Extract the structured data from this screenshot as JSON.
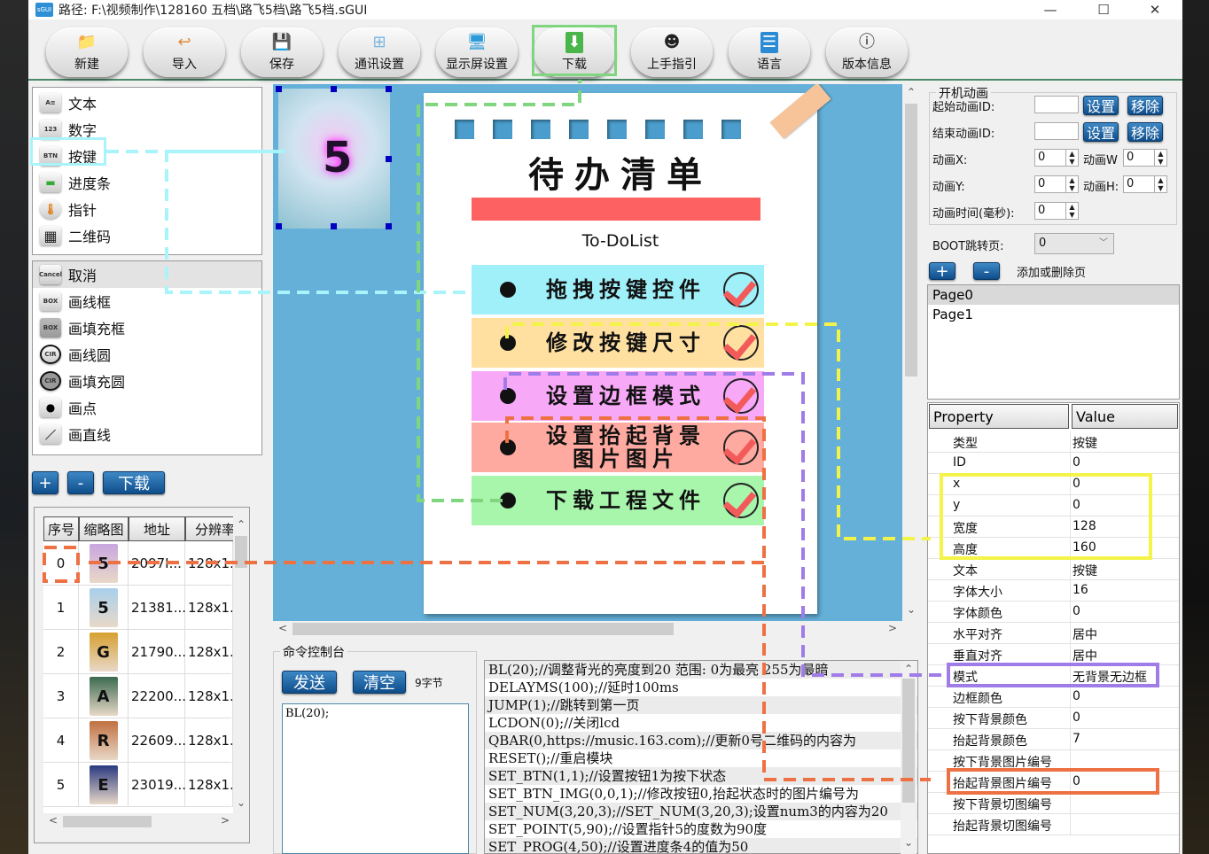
{
  "window": {
    "title": "路径: F:\\视频制作\\128160 五档\\路飞5档\\路飞5档.sGUI",
    "app_icon": "sGUI",
    "controls": {
      "minimize": "—",
      "maximize": "☐",
      "close": "✕"
    }
  },
  "toolbar": [
    {
      "label": "新建",
      "icon": "folder-icon",
      "glyph": "📁"
    },
    {
      "label": "导入",
      "icon": "import-icon",
      "glyph": "↩"
    },
    {
      "label": "保存",
      "icon": "save-icon",
      "glyph": "💾"
    },
    {
      "label": "通讯设置",
      "icon": "network-icon",
      "glyph": "⊞"
    },
    {
      "label": "显示屏设置",
      "icon": "monitor-icon",
      "glyph": "🖥"
    },
    {
      "label": "下载",
      "icon": "download-icon",
      "glyph": "⬇"
    },
    {
      "label": "上手指引",
      "icon": "support-icon",
      "glyph": "☻"
    },
    {
      "label": "语言",
      "icon": "list-icon",
      "glyph": "☰"
    },
    {
      "label": "版本信息",
      "icon": "info-icon",
      "glyph": "ⓘ"
    }
  ],
  "widgets": [
    {
      "label": "文本",
      "icon": "A≡"
    },
    {
      "label": "数字",
      "icon": "123"
    },
    {
      "label": "按键",
      "icon": "BTN"
    },
    {
      "label": "进度条",
      "icon": "▬"
    },
    {
      "label": "指针",
      "icon": "🌡"
    },
    {
      "label": "二维码",
      "icon": "▦"
    }
  ],
  "draw_tools": [
    {
      "label": "取消",
      "icon": "Cancel"
    },
    {
      "label": "画线框",
      "icon": "BOX"
    },
    {
      "label": "画填充框",
      "icon": "BOX"
    },
    {
      "label": "画线圆",
      "icon": "CIR"
    },
    {
      "label": "画填充圆",
      "icon": "CIR"
    },
    {
      "label": "画点",
      "icon": "●"
    },
    {
      "label": "画直线",
      "icon": "／"
    }
  ],
  "image_buttons": {
    "add": "+",
    "remove": "-",
    "download": "下载"
  },
  "image_table": {
    "headers": [
      "序号",
      "缩略图",
      "地址",
      "分辨率"
    ],
    "rows": [
      {
        "index": "0",
        "thumb_letter": "5",
        "address": "2097I...",
        "resolution": "128x1..."
      },
      {
        "index": "1",
        "thumb_letter": "5",
        "address": "21381...",
        "resolution": "128x1..."
      },
      {
        "index": "2",
        "thumb_letter": "G",
        "address": "21790...",
        "resolution": "128x1..."
      },
      {
        "index": "3",
        "thumb_letter": "A",
        "address": "22200...",
        "resolution": "128x1..."
      },
      {
        "index": "4",
        "thumb_letter": "R",
        "address": "22609...",
        "resolution": "128x1..."
      },
      {
        "index": "5",
        "thumb_letter": "E",
        "address": "23019...",
        "resolution": "128x1..."
      }
    ]
  },
  "canvas": {
    "button_image_number": "5",
    "note_title": "待办清单",
    "note_subtitle": "To-DoList",
    "todos": [
      {
        "text": "拖拽按键控件",
        "color": "#a0f0fa"
      },
      {
        "text": "修改按键尺寸",
        "color": "#ffe0a0"
      },
      {
        "text": "设置边框模式",
        "color": "#f7a8f7"
      },
      {
        "text": "设置抬起背景\n图片图片",
        "color": "#ffaaa0"
      },
      {
        "text": "下载工程文件",
        "color": "#a8f5ac"
      }
    ]
  },
  "console": {
    "title": "命令控制台",
    "send": "发送",
    "clear": "清空",
    "byte_count": "9字节",
    "input": "BL(20);",
    "commands": [
      "BL(20);//调整背光的亮度到20 范围: 0为最亮 255为最暗",
      "DELAYMS(100);//延时100ms",
      "JUMP(1);//跳转到第一页",
      "LCDON(0);//关闭lcd",
      "QBAR(0,https://music.163.com);//更新0号二维码的内容为",
      "RESET();//重启模块",
      "SET_BTN(1,1);//设置按钮1为按下状态",
      "SET_BTN_IMG(0,0,1);//修改按钮0,抬起状态时的图片编号为",
      "SET_NUM(3,20,3);//SET_NUM(3,20,3);设置num3的内容为20",
      "SET_POINT(5,90);//设置指针5的度数为90度",
      "SET_PROG(4,50);//设置进度条4的值为50"
    ]
  },
  "boot_anim": {
    "title": "开机动画",
    "start_id_label": "起始动画ID:",
    "end_id_label": "结束动画ID:",
    "set": "设置",
    "remove": "移除",
    "x_label": "动画X:",
    "x": "0",
    "y_label": "动画Y:",
    "y": "0",
    "w_label": "动画W",
    "w": "0",
    "h_label": "动画H:",
    "h": "0",
    "time_label": "动画时间(毫秒):",
    "time": "0",
    "boot_jump_label": "BOOT跳转页:",
    "boot_jump": "0"
  },
  "pages": {
    "add": "+",
    "remove": "-",
    "hint": "添加或删除页",
    "items": [
      "Page0",
      "Page1"
    ]
  },
  "properties": {
    "headers": [
      "Property",
      "Value"
    ],
    "rows": [
      {
        "k": "类型",
        "v": "按键"
      },
      {
        "k": "ID",
        "v": "0"
      },
      {
        "k": "x",
        "v": "0"
      },
      {
        "k": "y",
        "v": "0"
      },
      {
        "k": "宽度",
        "v": "128"
      },
      {
        "k": "高度",
        "v": "160"
      },
      {
        "k": "文本",
        "v": "按键"
      },
      {
        "k": "字体大小",
        "v": "16"
      },
      {
        "k": "字体颜色",
        "v": "0"
      },
      {
        "k": "水平对齐",
        "v": "居中"
      },
      {
        "k": "垂直对齐",
        "v": "居中"
      },
      {
        "k": "模式",
        "v": "无背景无边框"
      },
      {
        "k": "边框颜色",
        "v": "0"
      },
      {
        "k": "按下背景颜色",
        "v": "0"
      },
      {
        "k": "抬起背景颜色",
        "v": "7"
      },
      {
        "k": "按下背景图片编号",
        "v": ""
      },
      {
        "k": "抬起背景图片编号",
        "v": "0"
      },
      {
        "k": "按下背景切图编号",
        "v": ""
      },
      {
        "k": "抬起背景切图编号",
        "v": ""
      }
    ]
  },
  "colors": {
    "accent_blue": "#0e4d8a",
    "canvas_bg": "#65b0d9",
    "guide_cyan": "#a8f4fa",
    "guide_green": "#7fd67f",
    "guide_yellow": "#f3f34a",
    "guide_purple": "#a07ce8",
    "guide_orange": "#ee7144"
  }
}
